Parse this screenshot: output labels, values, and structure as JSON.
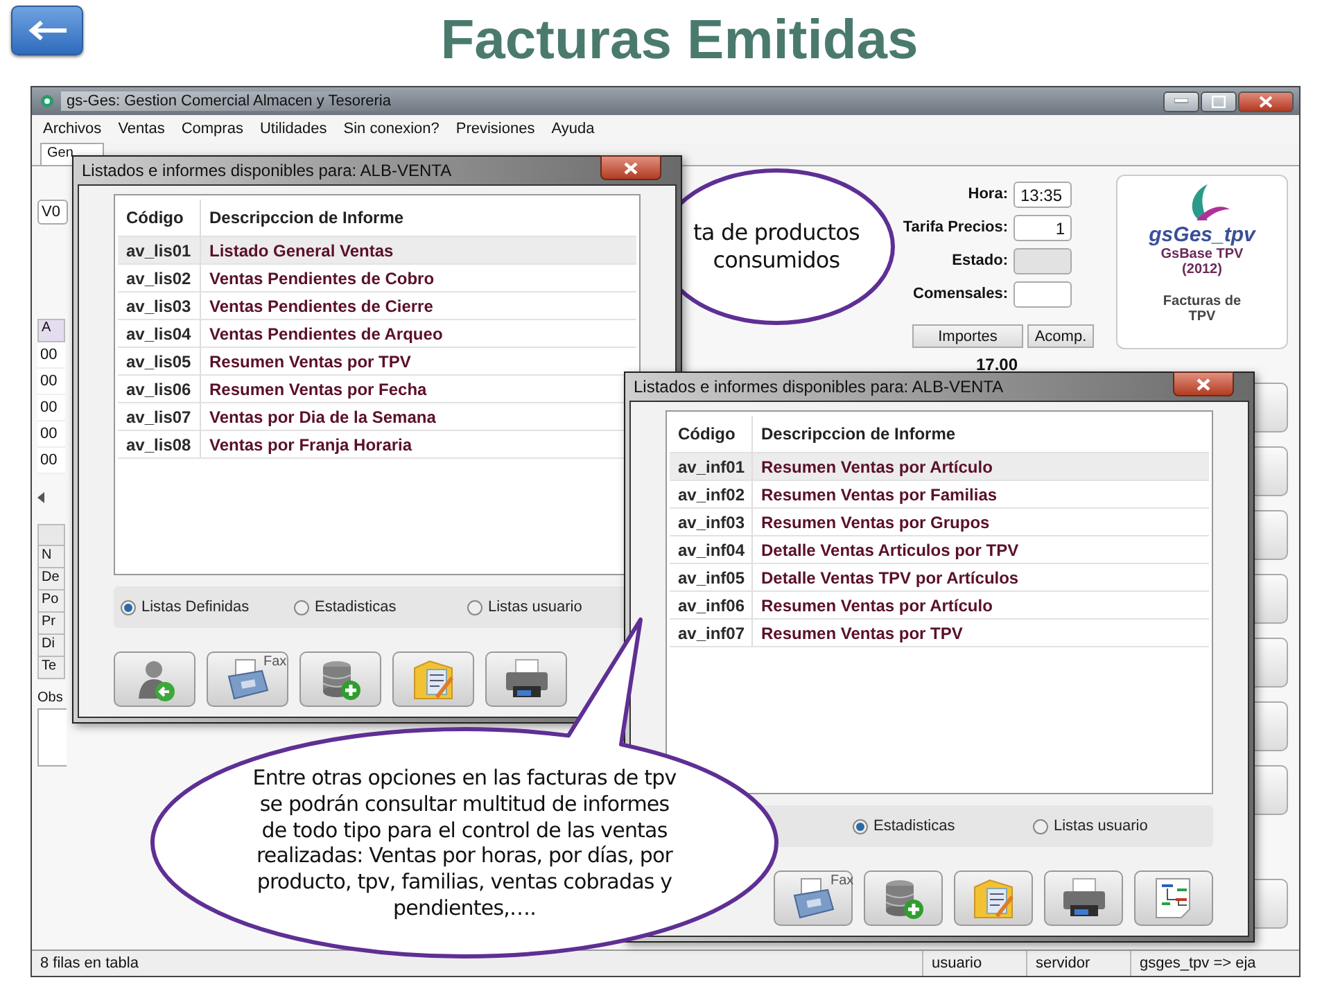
{
  "slide": {
    "title": "Facturas Emitidas"
  },
  "app": {
    "title": "gs-Ges: Gestion Comercial Almacen y Tesoreria",
    "menu": [
      "Archivos",
      "Ventas",
      "Compras",
      "Utilidades",
      "Sin conexion?",
      "Previsiones",
      "Ayuda"
    ],
    "tab": {
      "label": "Gen",
      "selected": true
    },
    "left_strip": {
      "field": "V0",
      "table_header": "A",
      "rows": [
        "00",
        "00",
        "00",
        "00",
        "00"
      ],
      "labels": [
        "N",
        "De",
        "Po",
        "Pr",
        "Di",
        "Te"
      ],
      "notes_label": "Obs"
    },
    "fields": [
      {
        "label": "Hora:",
        "value": "13:35",
        "kind": "text"
      },
      {
        "label": "Tarifa Precios:",
        "value": "1",
        "kind": "number"
      },
      {
        "label": "Estado:",
        "kind": "readonly"
      },
      {
        "label": "Comensales:",
        "kind": "text"
      }
    ],
    "grid": {
      "columns": [
        "Importes",
        "Acomp."
      ],
      "cells": [
        "17.00"
      ]
    },
    "logo": {
      "name": "gsGes_tpv",
      "product": "GsBase TPV",
      "year": "(2012)",
      "caption": "Facturas de TPV"
    },
    "status_bar": [
      "8 filas en tabla",
      "usuario",
      "servidor",
      "gsges_tpv => eja"
    ]
  },
  "dialogs": [
    {
      "title": "Listados e informes disponibles para: ALB-VENTA",
      "columns": [
        "Código",
        "Descripccion de Informe"
      ],
      "rows": [
        {
          "code": "av_lis01",
          "description": "Listado General Ventas",
          "selected": true
        },
        {
          "code": "av_lis02",
          "description": "Ventas Pendientes de Cobro",
          "selected": false
        },
        {
          "code": "av_lis03",
          "description": "Ventas Pendientes de Cierre",
          "selected": false
        },
        {
          "code": "av_lis04",
          "description": "Ventas Pendientes de Arqueo",
          "selected": false
        },
        {
          "code": "av_lis05",
          "description": "Resumen Ventas por TPV",
          "selected": false
        },
        {
          "code": "av_lis06",
          "description": "Resumen Ventas por Fecha",
          "selected": false
        },
        {
          "code": "av_lis07",
          "description": "Ventas por Dia de la Semana",
          "selected": false
        },
        {
          "code": "av_lis08",
          "description": "Ventas por Franja Horaria",
          "selected": false
        }
      ],
      "options": [
        {
          "label": "Listas Definidas",
          "selected": true
        },
        {
          "label": "Estadisticas",
          "selected": false
        },
        {
          "label": "Listas usuario",
          "selected": false
        }
      ],
      "buttons": [
        {
          "kind": "user-back"
        },
        {
          "kind": "fax",
          "label": "Fax"
        },
        {
          "kind": "database-add"
        },
        {
          "kind": "folder-edit"
        },
        {
          "kind": "printer"
        }
      ]
    },
    {
      "title": "Listados e informes disponibles para: ALB-VENTA",
      "columns": [
        "Código",
        "Descripccion de Informe"
      ],
      "rows": [
        {
          "code": "av_inf01",
          "description": "Resumen Ventas por Artículo",
          "selected": true
        },
        {
          "code": "av_inf02",
          "description": "Resumen Ventas por Familias",
          "selected": false
        },
        {
          "code": "av_inf03",
          "description": "Resumen Ventas por Grupos",
          "selected": false
        },
        {
          "code": "av_inf04",
          "description": "Detalle Ventas Articulos por TPV",
          "selected": false
        },
        {
          "code": "av_inf05",
          "description": "Detalle Ventas TPV por Artículos",
          "selected": false
        },
        {
          "code": "av_inf06",
          "description": "Resumen Ventas por Artículo",
          "selected": false
        },
        {
          "code": "av_inf07",
          "description": "Resumen Ventas por TPV",
          "selected": false
        }
      ],
      "options": [
        {
          "label": "Estadisticas",
          "selected": true
        },
        {
          "label": "Listas usuario",
          "selected": false
        }
      ],
      "buttons": [
        {
          "kind": "fax",
          "label": "Fax"
        },
        {
          "kind": "database-add"
        },
        {
          "kind": "folder-edit"
        },
        {
          "kind": "printer"
        },
        {
          "kind": "diagram"
        }
      ]
    }
  ],
  "callouts": [
    {
      "text": "ta de productos\nconsumidos"
    },
    {
      "text": "Entre otras opciones en las facturas de tpv\nse podrán consultar multitud de informes\nde todo tipo para el control de las ventas\nrealizadas: Ventas por horas, por días, por\nproducto, tpv, familias, ventas cobradas y\npendientes,…."
    }
  ]
}
